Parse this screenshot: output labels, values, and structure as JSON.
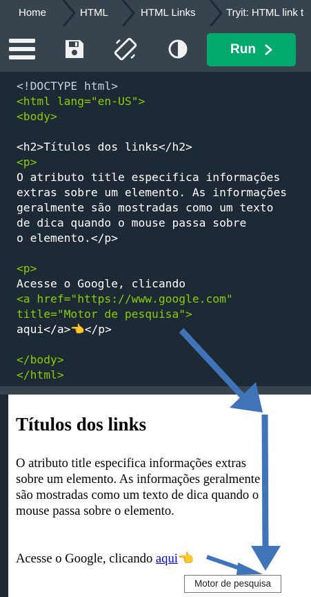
{
  "breadcrumb": {
    "items": [
      "Home",
      "HTML",
      "HTML Links",
      "Tryit: HTML link t"
    ]
  },
  "toolbar": {
    "icons": [
      "menu-icon",
      "save-icon",
      "rotate-icon",
      "theme-toggle-icon"
    ],
    "run_label": "Run",
    "run_color": "#04aa6d"
  },
  "code": {
    "lines": [
      "<!DOCTYPE html>",
      "<html lang=\"en-US\">",
      "<body>",
      "",
      "<h2>Títulos dos links</h2>",
      "<p>",
      "O atributo title especifica informações",
      "extras sobre um elemento. As informações",
      "geralmente são mostradas como um texto",
      "de dica quando o mouse passa sobre",
      "o elemento.</p>",
      "",
      "<p>",
      "Acesse o Google, clicando",
      "<a href=\"https://www.google.com\"",
      "title=\"Motor de pesquisa\">",
      "aqui</a>👈</p>",
      "",
      "</body>",
      "</html>"
    ]
  },
  "result": {
    "heading": "Títulos dos links",
    "paragraph": "O atributo title especifica informações extras sobre um elemento. As informações geralmente são mostradas como um texto de dica quando o mouse passa sobre o elemento.",
    "link_prefix": "Acesse o Google, clicando ",
    "link_text": "aqui",
    "link_emoji": "👈",
    "tooltip": "Motor de pesquisa"
  },
  "colors": {
    "editor_bg": "#1d2a35",
    "toolbar_bg": "#38444d",
    "tag_green": "#88ce02",
    "annotation_arrow": "#3f74b8"
  }
}
